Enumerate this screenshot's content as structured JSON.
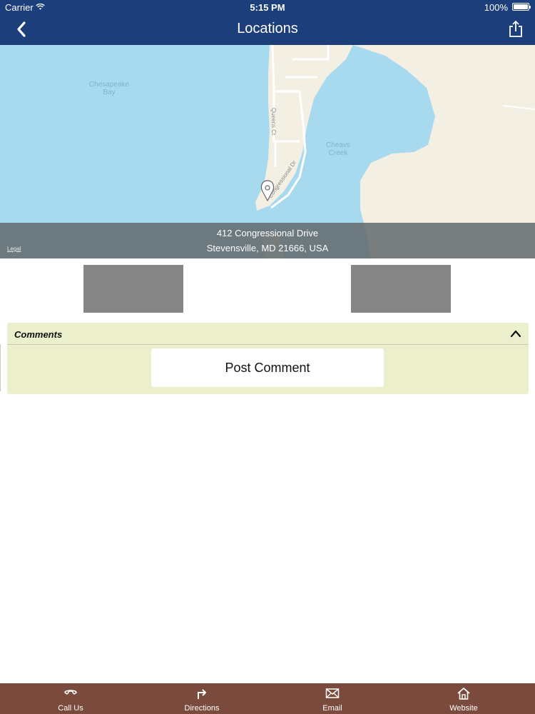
{
  "status_bar": {
    "carrier": "Carrier",
    "time": "5:15 PM",
    "battery": "100%"
  },
  "nav": {
    "title": "Locations",
    "back_icon": "chevron-left-icon",
    "share_icon": "share-icon"
  },
  "map": {
    "labels": {
      "bay_line1": "Chesapeake",
      "bay_line2": "Bay",
      "creek_line1": "Cheavs",
      "creek_line2": "Creek",
      "street1": "Queens Ct",
      "street2": "Congressional Dr"
    },
    "address_line1": "412 Congressional Drive",
    "address_line2": "Stevensville, MD 21666, USA",
    "legal": "Legal",
    "colors": {
      "water": "#a8daef",
      "land": "#f4efe3"
    }
  },
  "comments": {
    "title": "Comments",
    "post_button": "Post Comment"
  },
  "tab_bar": {
    "items": [
      {
        "label": "Call Us",
        "icon": "phone-icon"
      },
      {
        "label": "Directions",
        "icon": "directions-arrow-icon"
      },
      {
        "label": "Email",
        "icon": "envelope-icon"
      },
      {
        "label": "Website",
        "icon": "home-icon"
      }
    ]
  },
  "colors": {
    "header": "#1c3f7c",
    "tab_bar": "#7a4b3c",
    "comments_bg": "#ecefcc",
    "placeholder": "#868686"
  }
}
